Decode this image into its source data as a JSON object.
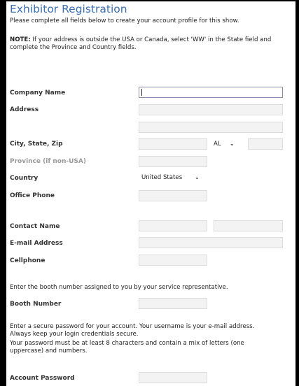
{
  "header": {
    "title": "Exhibitor Registration",
    "subtitle": "Please complete all fields below to create your account profile for this show."
  },
  "note": {
    "prefix": "NOTE:",
    "line1": " If your address is outside the USA or Canada, select 'WW' in the State field and",
    "line2": "complete the Province and Country fields."
  },
  "form": {
    "company_label": "Company Name",
    "address_label": "Address",
    "city_state_zip_label": "City, State, Zip",
    "state_value": "AL",
    "province_label": "Province (if non-USA)",
    "country_label": "Country",
    "country_value": "United States",
    "office_phone_label": "Office Phone",
    "contact_name_label": "Contact Name",
    "email_label": "E-mail Address",
    "cellphone_label": "Cellphone",
    "booth_instructions": "Enter the booth number assigned to you by your service representative.",
    "booth_label": "Booth Number",
    "password_line1": "Enter a secure password for your account. Your username is your e-mail address.",
    "password_line2": "Always keep your login credentials secure.",
    "password_line3": "Your password must be at least 8 characters and contain a mix of letters (one",
    "password_line4": "uppercase) and numbers.",
    "password_label": "Account Password"
  },
  "icons": {
    "dropdown": "chevron-down-icon"
  }
}
